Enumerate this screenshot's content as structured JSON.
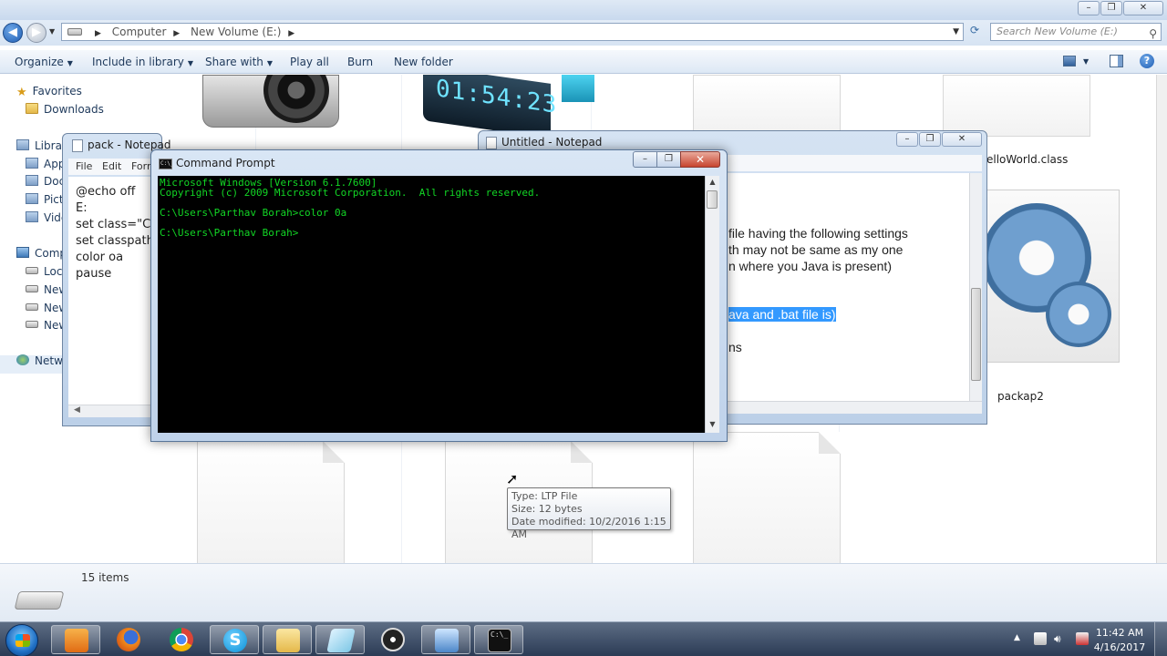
{
  "explorer": {
    "breadcrumb": [
      "Computer",
      "New Volume (E:)"
    ],
    "search_placeholder": "Search New Volume (E:)",
    "toolbar": {
      "organize": "Organize",
      "include_in_library": "Include in library",
      "share_with": "Share with",
      "play_all": "Play all",
      "burn": "Burn",
      "new_folder": "New folder"
    },
    "nav": {
      "favorites": "Favorites",
      "downloads": "Downloads",
      "libraries": "Librari",
      "apps": "App",
      "docs": "Doc",
      "pictures": "Pict",
      "videos": "Vide",
      "computer": "Compu",
      "local": "Loca",
      "new1": "New",
      "new2": "New",
      "new3": "New",
      "network": "Netwo"
    },
    "files": {
      "clock_digits": "01:54:23",
      "helloworld": "elloWorld.class",
      "packap2": "packap2"
    },
    "items_count": "15 items"
  },
  "notepad_pack": {
    "title": "pack - Notepad",
    "menu": [
      "File",
      "Edit",
      "Forn"
    ],
    "content": "@echo off\nE:\nset class=\"C:\nset classpath\ncolor oa\npause"
  },
  "notepad_untitled": {
    "title": "Untitled - Notepad",
    "lines": [
      "file having the following settings",
      "th may not be same as my one",
      "n where you Java is present)",
      "ava and .bat file is)",
      "ns"
    ]
  },
  "cmd": {
    "title": "Command Prompt",
    "icon_text": "C:\\_",
    "console": "Microsoft Windows [Version 6.1.7600]\nCopyright (c) 2009 Microsoft Corporation.  All rights reserved.\n\nC:\\Users\\Parthav Borah>color 0a\n\nC:\\Users\\Parthav Borah>",
    "text_color": "#12d625"
  },
  "tooltip": {
    "type": "Type: LTP File",
    "size": "Size: 12 bytes",
    "date": "Date modified: 10/2/2016 1:15 AM"
  },
  "taskbar": {
    "time": "11:42 AM",
    "date": "4/16/2017",
    "apps": [
      "media-player",
      "firefox",
      "chrome",
      "skype",
      "explorer",
      "notepad",
      "obs",
      "control-panel",
      "command-prompt"
    ]
  }
}
